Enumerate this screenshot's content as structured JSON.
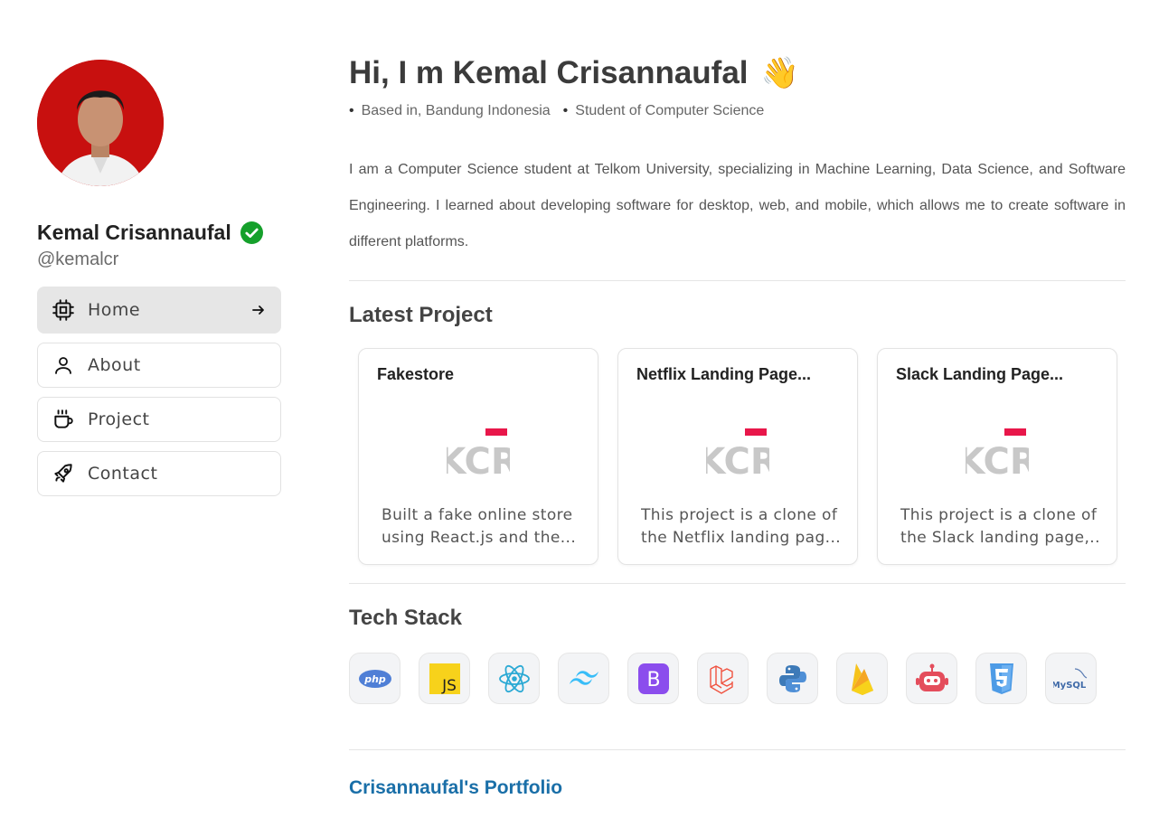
{
  "profile": {
    "name": "Kemal Crisannaufal",
    "handle": "@kemalcr"
  },
  "nav": {
    "items": [
      {
        "label": "Home",
        "icon": "cpu-icon",
        "active": true
      },
      {
        "label": "About",
        "icon": "user-icon"
      },
      {
        "label": "Project",
        "icon": "coffee-icon"
      },
      {
        "label": "Contact",
        "icon": "rocket-icon"
      }
    ]
  },
  "hero": {
    "title": "Hi, I m Kemal Crisannaufal",
    "wave": "👋",
    "location": "Based in, Bandung Indonesia",
    "role": "Student of Computer Science",
    "intro": "I am a Computer Science student at Telkom University, specializing in Machine Learning, Data Science, and Software Engineering. I learned about developing software for desktop, web, and mobile, which allows me to create software in different platforms."
  },
  "projects": {
    "title": "Latest Project",
    "logo_text": "KCR",
    "items": [
      {
        "title": "Fakestore",
        "desc1": "Built a fake online store",
        "desc2": "using React.js and the..."
      },
      {
        "title": "Netflix Landing Page...",
        "desc1": "This project is a clone of",
        "desc2": "the Netflix landing pag..."
      },
      {
        "title": "Slack Landing Page...",
        "desc1": "This project is a clone of",
        "desc2": "the Slack landing page,..."
      }
    ]
  },
  "tech": {
    "title": "Tech Stack",
    "items": [
      "php-icon",
      "javascript-icon",
      "react-icon",
      "tailwind-icon",
      "bootstrap-icon",
      "laravel-icon",
      "python-icon",
      "firebase-icon",
      "robot-icon",
      "css3-icon",
      "mysql-icon"
    ],
    "labels": {
      "php": "php",
      "js": "JS",
      "bootstrap": "B",
      "mysql": "MySQL"
    }
  },
  "footer": {
    "link": "Crisannaufal's Portfolio"
  },
  "colors": {
    "accent_red": "#e8174a",
    "verified_green": "#15a02b",
    "link_blue": "#1a6fa8"
  }
}
